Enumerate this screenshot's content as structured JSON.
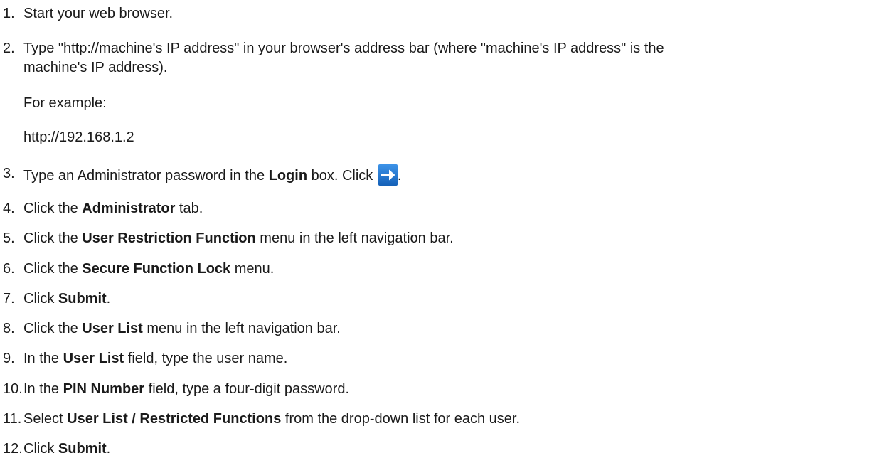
{
  "steps": [
    {
      "num": "1.",
      "text": "Start your web browser."
    },
    {
      "num": "2.",
      "line1": "Type \"http://machine's IP address\" in your browser's address bar (where \"machine's IP address\" is the",
      "line2": "machine's IP address).",
      "example_label": "For example:",
      "example_url": "http://192.168.1.2"
    },
    {
      "num": "3.",
      "pre": "Type an Administrator password in the ",
      "bold": "Login",
      "post": " box. Click ",
      "end": "."
    },
    {
      "num": "4.",
      "pre": "Click the ",
      "bold": "Administrator",
      "post": " tab."
    },
    {
      "num": "5.",
      "pre": "Click the ",
      "bold": "User Restriction Function",
      "post": " menu in the left navigation bar."
    },
    {
      "num": "6.",
      "pre": "Click the ",
      "bold": "Secure Function Lock",
      "post": " menu."
    },
    {
      "num": "7.",
      "pre": "Click ",
      "bold": "Submit",
      "post": "."
    },
    {
      "num": "8.",
      "pre": "Click the ",
      "bold": "User List",
      "post": " menu in the left navigation bar."
    },
    {
      "num": "9.",
      "pre": "In the ",
      "bold": "User List",
      "post": " field, type the user name."
    },
    {
      "num": "10.",
      "pre": "In the ",
      "bold": "PIN Number",
      "post": " field, type a four-digit password."
    },
    {
      "num": "11.",
      "pre": "Select ",
      "bold": "User List / Restricted Functions",
      "post": " from the drop-down list for each user."
    },
    {
      "num": "12.",
      "pre": "Click ",
      "bold": "Submit",
      "post": "."
    }
  ],
  "icons": {
    "go_button": "arrow-right-icon",
    "go_button_color": "#1e73d2"
  }
}
